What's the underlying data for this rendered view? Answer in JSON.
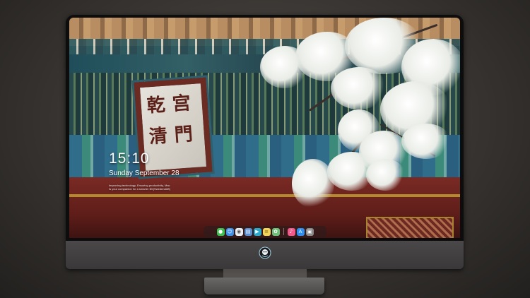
{
  "lockscreen": {
    "time": "15:10",
    "date": "Sunday September 28",
    "tagline_line1": "Improving technology, Ensuring productivity, Mac",
    "tagline_line2": "Is your companion for a smarter life(Sweden&88)"
  },
  "dock": {
    "apps": [
      {
        "name": "messages-icon",
        "color": "#3fbf4f"
      },
      {
        "name": "finder-icon",
        "color": "#3c8fe8"
      },
      {
        "name": "safari-icon",
        "color": "#e9eef2"
      },
      {
        "name": "preview-icon",
        "color": "#5a8fd0"
      },
      {
        "name": "clapper-icon",
        "color": "#2aa7c9"
      },
      {
        "name": "notes-icon",
        "color": "#f2d45a"
      },
      {
        "name": "photos-icon",
        "color": "#6fbf7a"
      },
      {
        "name": "music-icon",
        "color": "#f05a8a"
      },
      {
        "name": "app-store-icon",
        "color": "#2f8ff0"
      },
      {
        "name": "camera-icon",
        "color": "#8a8a8a"
      }
    ]
  },
  "colors": {
    "background": "#3c3835",
    "bezel": "#0d0d0e",
    "chin": "#454344"
  }
}
